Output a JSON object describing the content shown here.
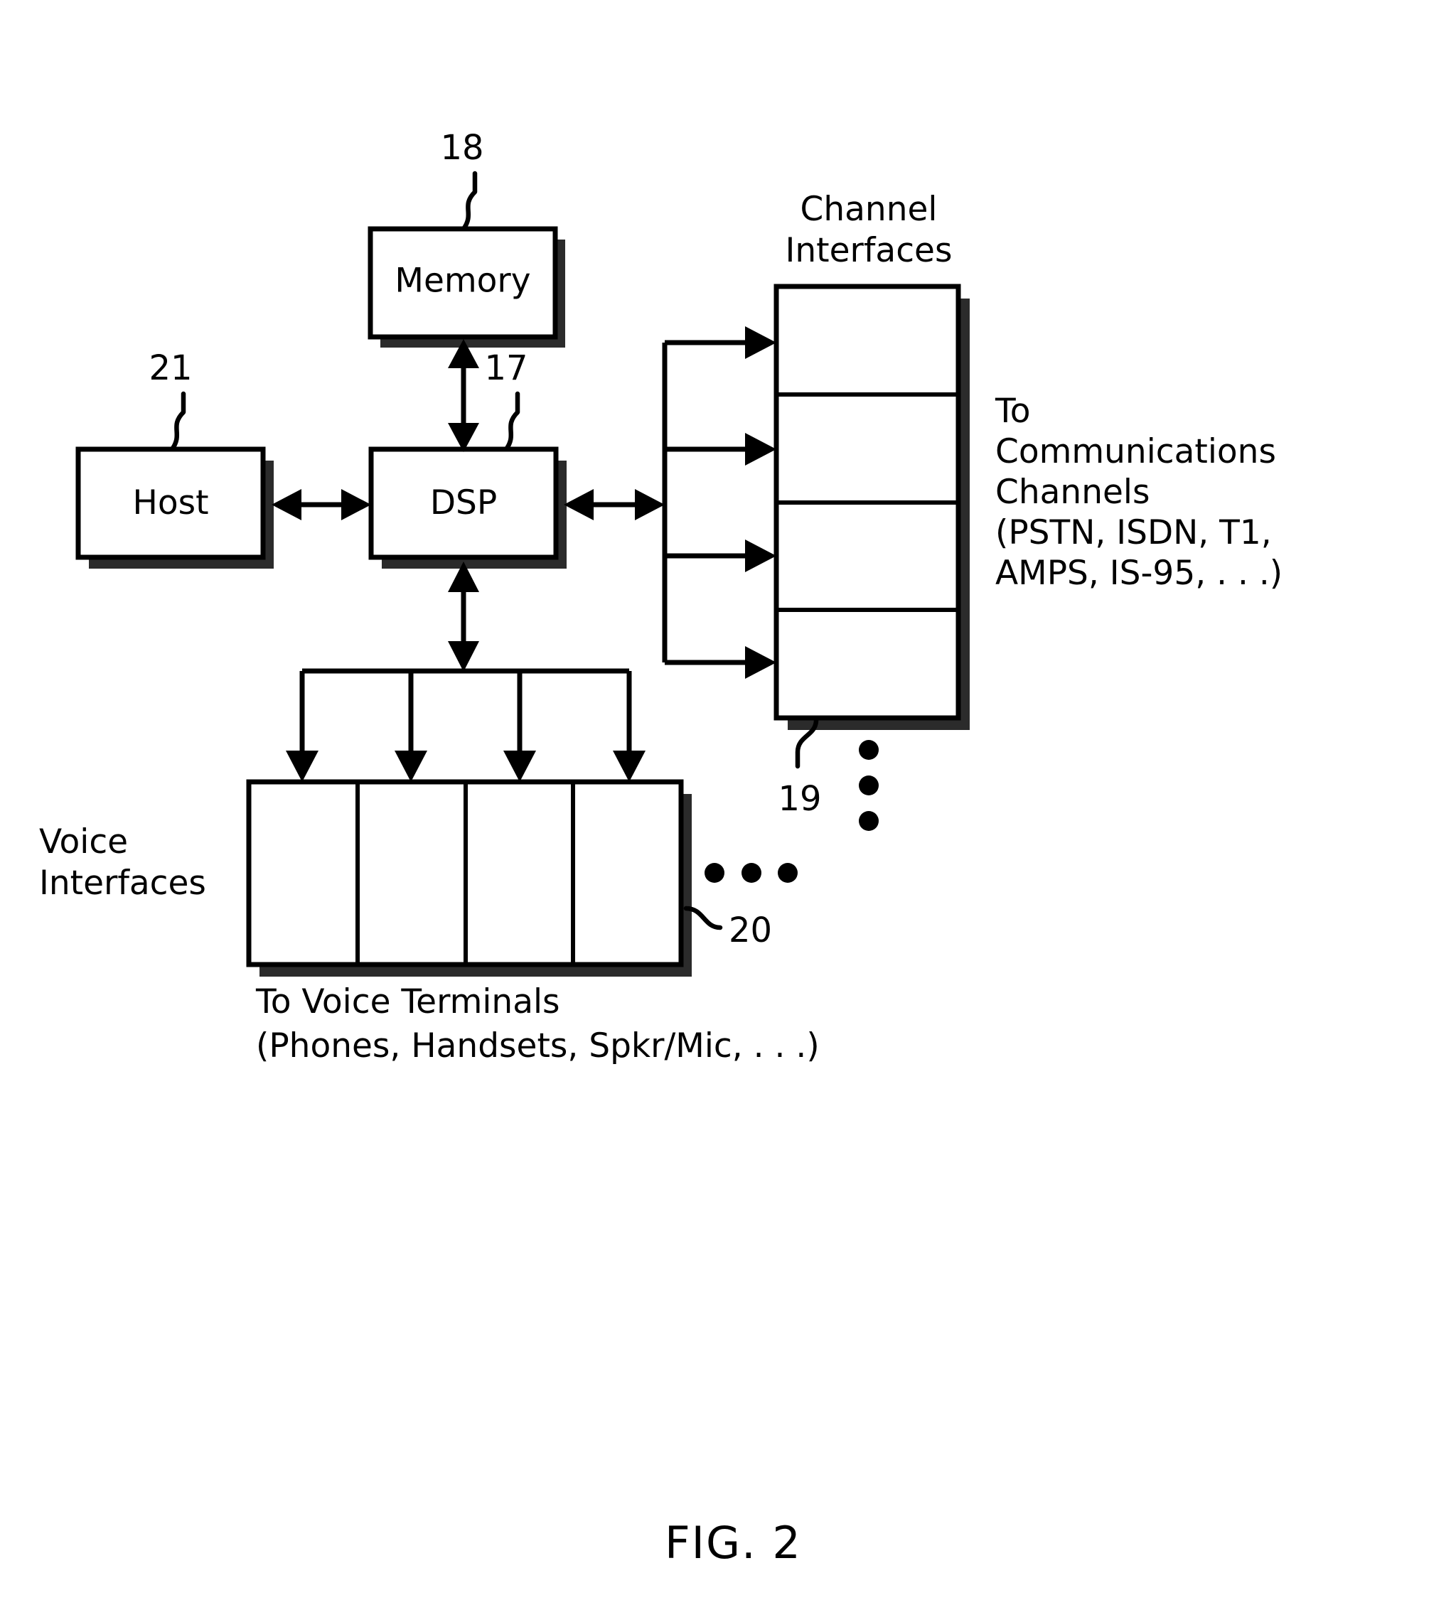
{
  "figure": {
    "caption": "FIG. 2",
    "blocks": {
      "memory": {
        "label": "Memory",
        "ref": "18"
      },
      "host": {
        "label": "Host",
        "ref": "21"
      },
      "dsp": {
        "label": "DSP",
        "ref": "17"
      },
      "channel_interfaces": {
        "title_line1": "Channel",
        "title_line2": "Interfaces",
        "ref": "19",
        "cell_count": 4
      },
      "voice_interfaces": {
        "title_line1": "Voice",
        "title_line2": "Interfaces",
        "ref": "20",
        "cell_count": 4
      }
    },
    "annotations": {
      "channels": [
        "To",
        "Communications",
        "Channels",
        "(PSTN, ISDN, T1,",
        "AMPS, IS-95, . . .)"
      ],
      "voice_terminals": [
        "To Voice Terminals",
        "(Phones, Handsets, Spkr/Mic, . . .)"
      ]
    },
    "colors": {
      "stroke": "#000000",
      "fill": "#ffffff",
      "shadow": "#2b2b2b",
      "background": "#ffffff"
    }
  }
}
